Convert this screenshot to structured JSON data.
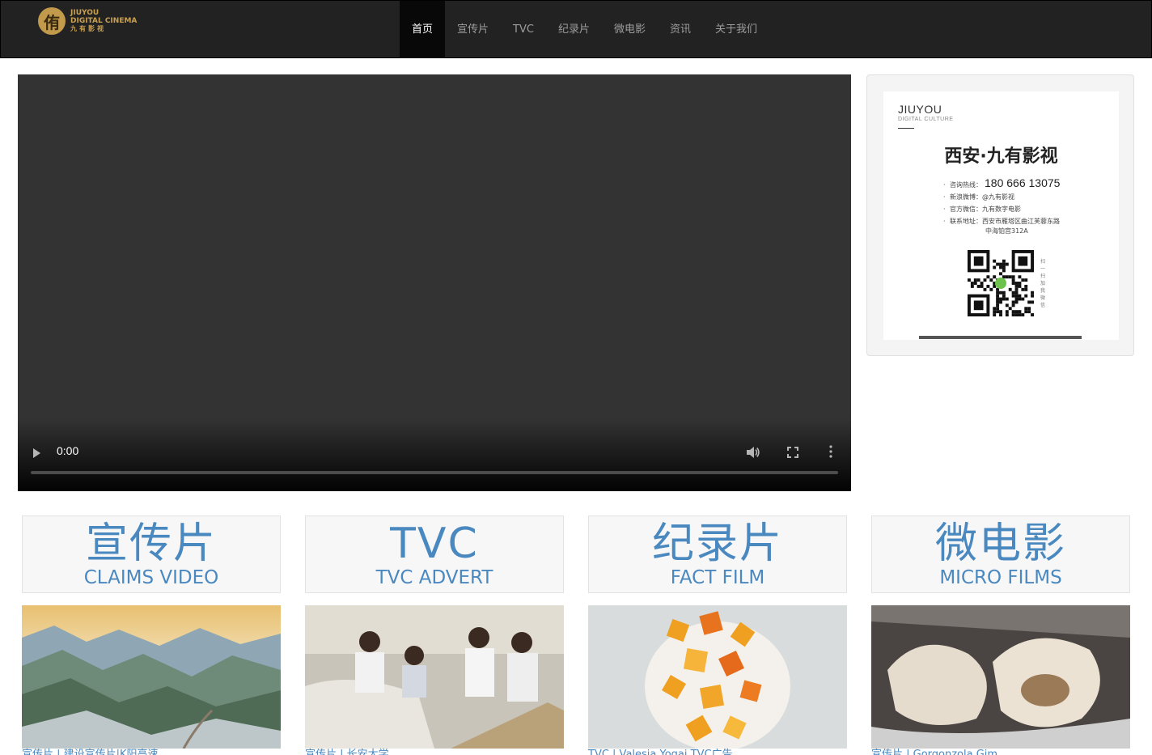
{
  "header": {
    "logo": {
      "mark": "侑",
      "line1": "JIUYOU",
      "line2": "DIGITAL CINEMA",
      "line3": "九有影视"
    },
    "nav": [
      {
        "label": "首页",
        "active": true
      },
      {
        "label": "宣传片",
        "active": false
      },
      {
        "label": "TVC",
        "active": false
      },
      {
        "label": "纪录片",
        "active": false
      },
      {
        "label": "微电影",
        "active": false
      },
      {
        "label": "资讯",
        "active": false
      },
      {
        "label": "关于我们",
        "active": false
      }
    ]
  },
  "video": {
    "time": "0:00"
  },
  "contact_card": {
    "brand": "JIUYOU",
    "brand_sub": "DIGITAL CULTURE",
    "title": "西安·九有影视",
    "hotline_label": "咨询热线：",
    "hotline": "180 666 13075",
    "weibo": "新浪微博：@九有影视",
    "wechat": "官方微信：九有数字电影",
    "address_line1": "联系地址：西安市雁塔区曲江芙蓉东路",
    "address_line2": "中海铂宫312A",
    "qr_note": "扫一扫加我微信"
  },
  "categories": [
    {
      "cn": "宣传片",
      "en": "CLAIMS VIDEO",
      "caption": "宣传片 | 建设宣传片|K阳高速"
    },
    {
      "cn": "TVC",
      "en": "TVC ADVERT",
      "caption": "宣传片 | 长安大学"
    },
    {
      "cn": "纪录片",
      "en": "FACT FILM",
      "caption": "TVC | Valesia Yogai TVC广告"
    },
    {
      "cn": "微电影",
      "en": "MICRO FILMS",
      "caption": "宣传片 | Gorgonzola Gim"
    }
  ],
  "colors": {
    "accent": "#4a88c0",
    "header_bg": "#222222",
    "logo_gold": "#c29a4b"
  }
}
